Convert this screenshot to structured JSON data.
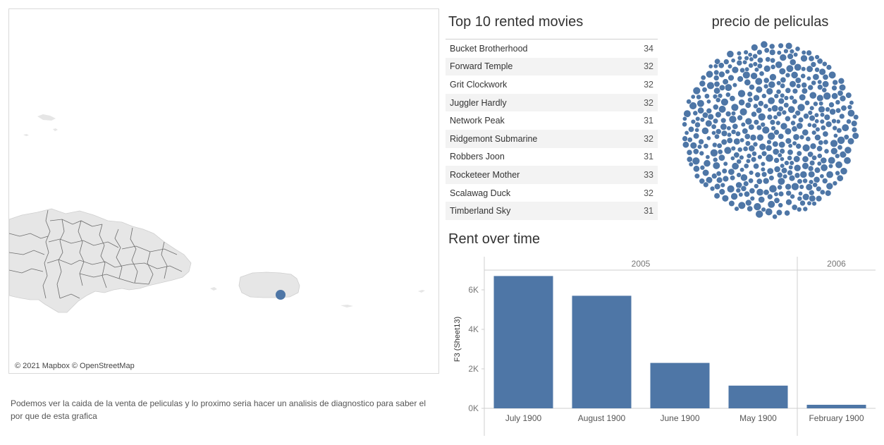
{
  "map": {
    "attribution": "© 2021 Mapbox © OpenStreetMap",
    "marker_color": "#4e76a6",
    "land_color": "#e8e8e8"
  },
  "note": "Podemos ver la caida de la venta de peliculas y lo proximo seria hacer un analisis de diagnostico para saber el por que de esta grafica",
  "top10": {
    "title": "Top 10 rented movies",
    "rows": [
      {
        "name": "Bucket Brotherhood",
        "value": "34"
      },
      {
        "name": "Forward Temple",
        "value": "32"
      },
      {
        "name": "Grit Clockwork",
        "value": "32"
      },
      {
        "name": "Juggler Hardly",
        "value": "32"
      },
      {
        "name": "Network Peak",
        "value": "31"
      },
      {
        "name": "Ridgemont Submarine",
        "value": "32"
      },
      {
        "name": "Robbers Joon",
        "value": "31"
      },
      {
        "name": "Rocketeer Mother",
        "value": "33"
      },
      {
        "name": "Scalawag Duck",
        "value": "32"
      },
      {
        "name": "Timberland Sky",
        "value": "31"
      }
    ]
  },
  "bubble": {
    "title": "precio de peliculas",
    "color": "#4e76a6"
  },
  "chart_data": {
    "type": "bar",
    "title": "Rent over time",
    "ylabel": "F3 (Sheet13)",
    "xlabel": "",
    "color": "#4e76a6",
    "ylim": [
      0,
      7000
    ],
    "yticks": [
      0,
      2000,
      4000,
      6000
    ],
    "ytick_labels": [
      "0K",
      "2K",
      "4K",
      "6K"
    ],
    "groups": [
      {
        "label": "2005",
        "categories": [
          "July 1900",
          "August 1900",
          "June 1900",
          "May 1900"
        ],
        "values": [
          6700,
          5700,
          2300,
          1150
        ]
      },
      {
        "label": "2006",
        "categories": [
          "February 1900"
        ],
        "values": [
          180
        ]
      }
    ],
    "grid": false
  }
}
